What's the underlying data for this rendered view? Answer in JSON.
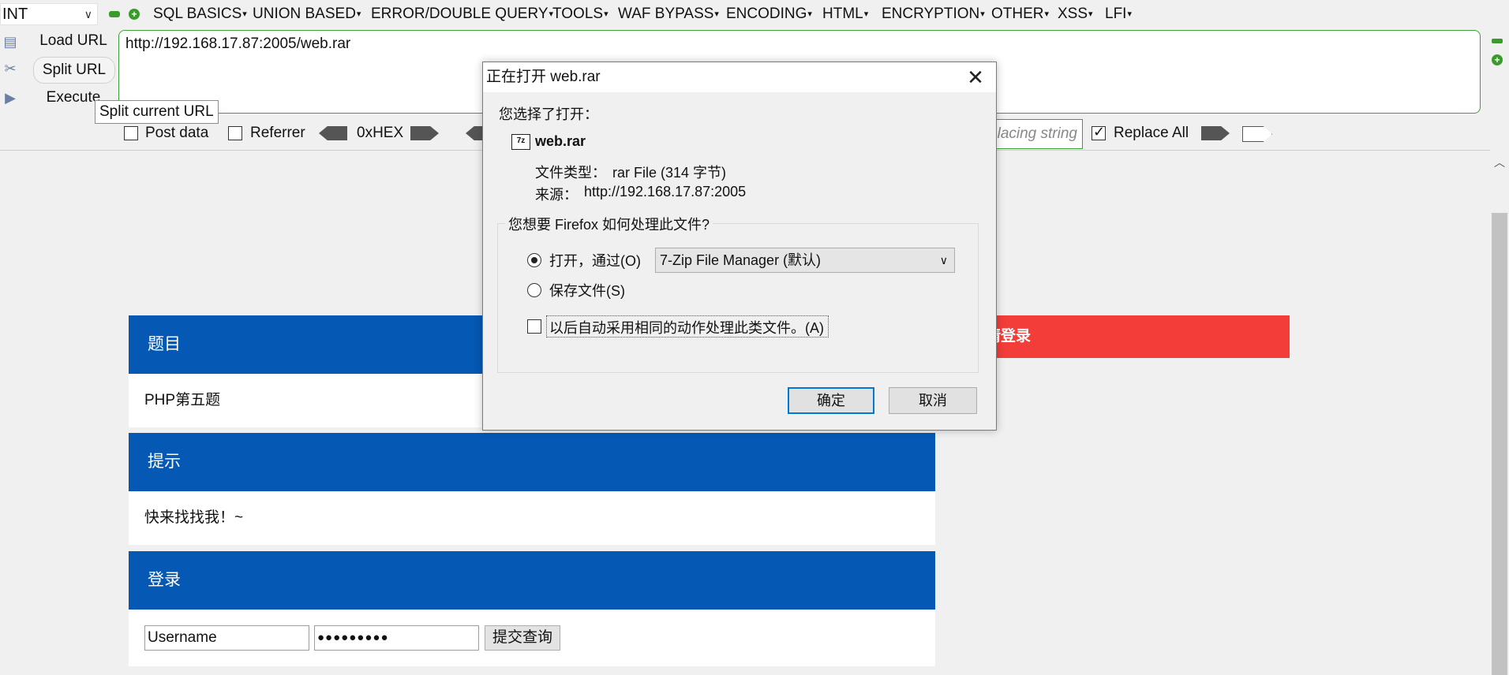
{
  "hackbar": {
    "injection_type": "INT",
    "menus": [
      "SQL BASICS",
      "UNION BASED",
      "ERROR/DOUBLE QUERY",
      "TOOLS",
      "WAF BYPASS",
      "ENCODING",
      "HTML",
      "ENCRYPTION",
      "OTHER",
      "XSS",
      "LFI"
    ],
    "load_url": "Load URL",
    "split_url": "Split URL",
    "execute": "Execute",
    "url_value": "http://192.168.17.87:2005/web.rar",
    "tooltip": "Split current URL",
    "post_data": "Post data",
    "referrer": "Referrer",
    "hex_label": "0xHEX",
    "replacing_placeholder": "lacing string",
    "replace_all": "Replace All",
    "accent_color": "#3aa23a"
  },
  "page": {
    "panel1_title": "题目",
    "panel1_body": "PHP第五题",
    "panel2_title": "提示",
    "panel2_body": "快来找找我！~",
    "panel3_title": "登录",
    "username_value": "Username",
    "password_value": "●●●●●●●●●",
    "submit_label": "提交查询",
    "red_button_label": "请登录",
    "header_color": "#0558b4",
    "red_color": "#f33d38"
  },
  "dialog": {
    "title": "正在打开 web.rar",
    "chosen_label": "您选择了打开：",
    "file_name": "web.rar",
    "file_type_label": "文件类型：",
    "file_type_value": "rar File (314 字节)",
    "source_label": "来源：",
    "source_value": "http://192.168.17.87:2005",
    "question": "您想要 Firefox 如何处理此文件?",
    "open_with": "打开，通过(O)",
    "app_choice": "7-Zip File Manager (默认)",
    "save_file": "保存文件(S)",
    "auto_action": "以后自动采用相同的动作处理此类文件。(A)",
    "ok": "确定",
    "cancel": "取消"
  }
}
